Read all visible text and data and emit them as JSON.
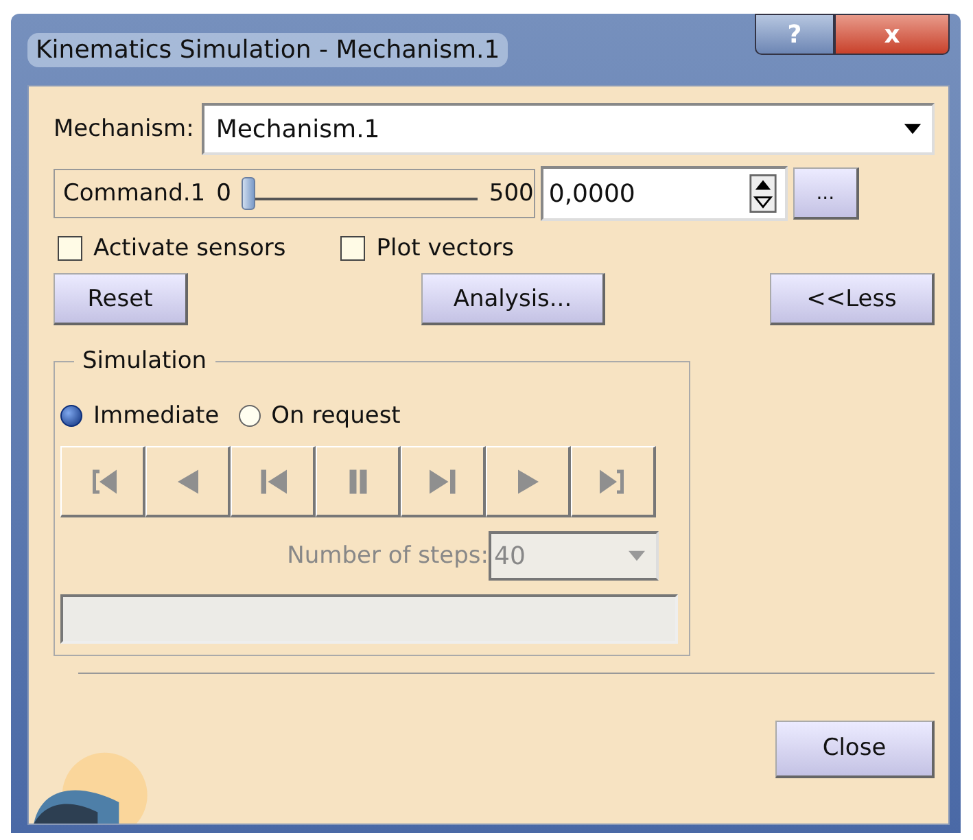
{
  "window": {
    "title": "Kinematics Simulation - Mechanism.1",
    "help_button": "?",
    "close_button": "x"
  },
  "mechanism": {
    "label": "Mechanism:",
    "value": "Mechanism.1"
  },
  "command": {
    "label": "Command.1",
    "min": "0",
    "max": "500",
    "level": 0,
    "value": "0,0000",
    "more_button": "..."
  },
  "checkboxes": [
    {
      "label": "Activate sensors",
      "checked": false
    },
    {
      "label": "Plot vectors",
      "checked": false
    }
  ],
  "buttons": {
    "reset": "Reset",
    "analysis": "Analysis...",
    "less": "<<Less"
  },
  "simulation": {
    "title": "Simulation",
    "modes": [
      {
        "label": "Immediate",
        "selected": true
      },
      {
        "label": "On request",
        "selected": false
      }
    ],
    "transport": [
      {
        "kind": "first",
        "disabled": true
      },
      {
        "kind": "back",
        "disabled": true
      },
      {
        "kind": "step-back",
        "disabled": true
      },
      {
        "kind": "pause",
        "disabled": true
      },
      {
        "kind": "step-forward",
        "disabled": true
      },
      {
        "kind": "play",
        "disabled": true
      },
      {
        "kind": "last",
        "disabled": true
      }
    ],
    "steps": {
      "label": "Number of steps:",
      "value": "40",
      "disabled": true
    },
    "progress": {
      "level": 0
    }
  },
  "close": "Close"
}
